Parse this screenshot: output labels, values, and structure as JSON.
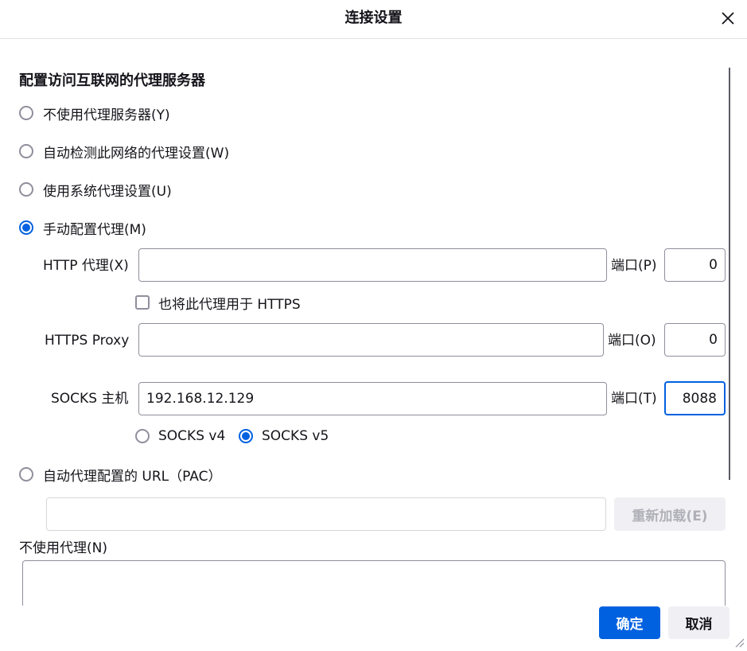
{
  "dialog": {
    "title": "连接设置"
  },
  "section": {
    "heading": "配置访问互联网的代理服务器"
  },
  "proxy_modes": {
    "no_proxy": "不使用代理服务器(Y)",
    "auto_detect": "自动检测此网络的代理设置(W)",
    "system": "使用系统代理设置(U)",
    "manual": "手动配置代理(M)",
    "selected": "manual"
  },
  "manual": {
    "http_label": "HTTP 代理(X)",
    "http_value": "",
    "http_port_label": "端口(P)",
    "http_port": "0",
    "also_https_label": "也将此代理用于 HTTPS",
    "also_https_checked": false,
    "https_label": "HTTPS Proxy",
    "https_value": "",
    "https_port_label": "端口(O)",
    "https_port": "0",
    "socks_label": "SOCKS 主机",
    "socks_value": "192.168.12.129",
    "socks_port_label": "端口(T)",
    "socks_port": "8088",
    "socks_v4": "SOCKS v4",
    "socks_v5": "SOCKS v5",
    "socks_version_selected": "v5"
  },
  "pac": {
    "label": "自动代理配置的 URL（PAC）",
    "url_value": "",
    "reload_label": "重新加载(E)"
  },
  "no_proxy_for": {
    "label": "不使用代理(N)",
    "value": ""
  },
  "footer": {
    "ok_label": "确定",
    "cancel_label": "取消"
  },
  "colors": {
    "accent": "#0061e0",
    "border": "#8f8f9d",
    "text": "#15141a"
  },
  "icons": {
    "close": "close-icon",
    "resize": "resize-grip-icon"
  }
}
